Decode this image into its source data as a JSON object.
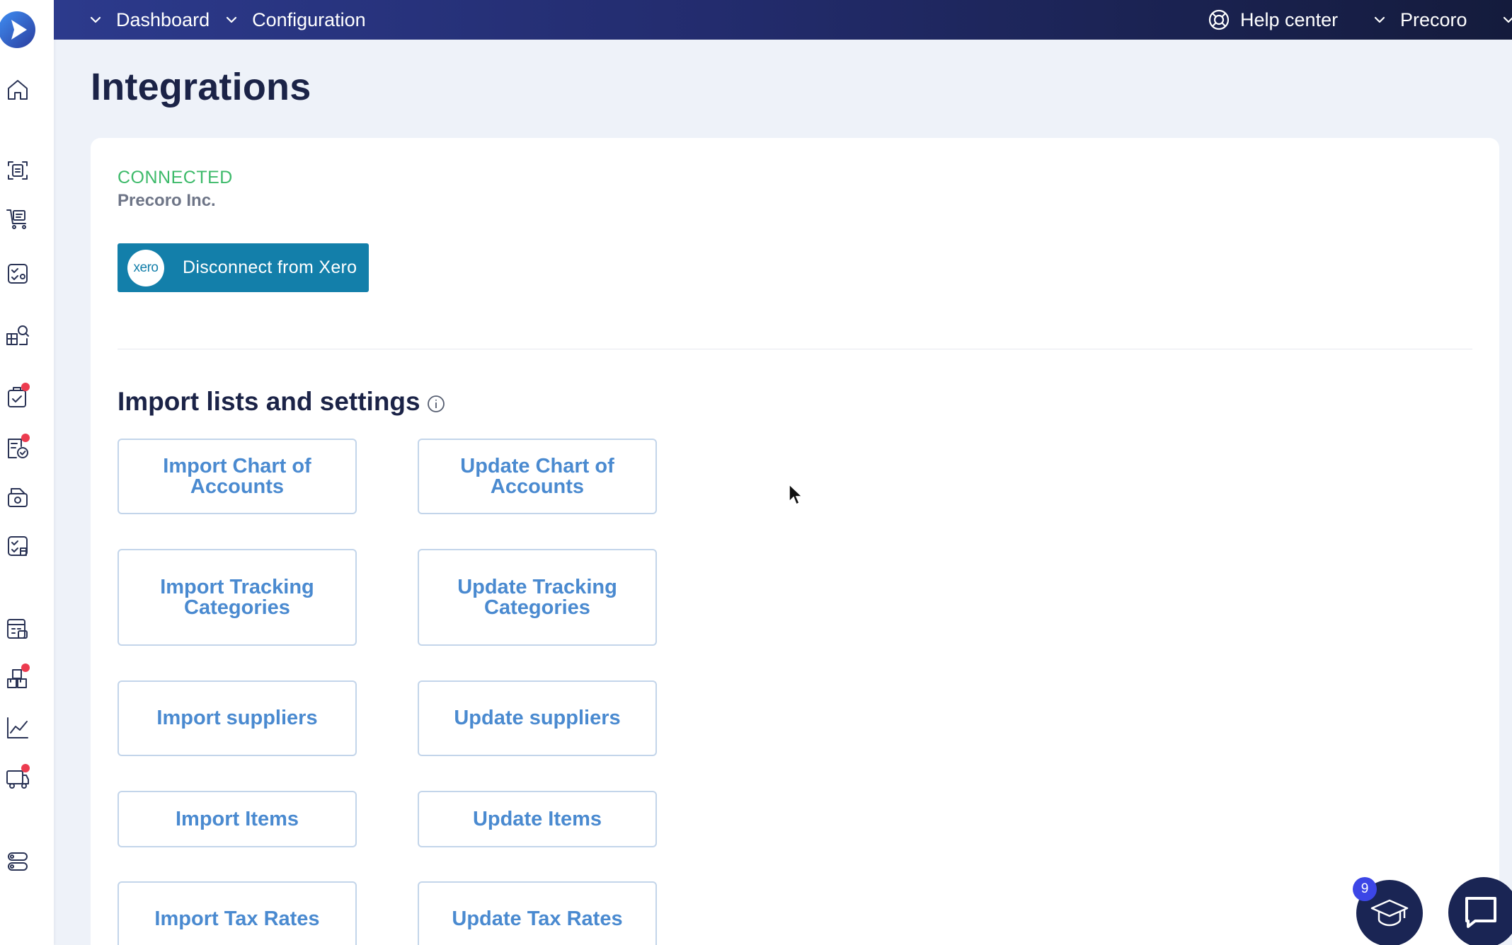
{
  "topbar": {
    "nav": [
      {
        "label": "Dashboard"
      },
      {
        "label": "Configuration"
      }
    ],
    "help_center_label": "Help center",
    "company_switch_label": "Precoro"
  },
  "sidebar": {
    "icons": [
      {
        "name": "home-icon",
        "badge": false
      },
      {
        "name": "requisitions-icon",
        "badge": false
      },
      {
        "name": "purchase-orders-icon",
        "badge": false
      },
      {
        "name": "approvals-icon",
        "badge": false
      },
      {
        "name": "suppliers-search-icon",
        "badge": false
      },
      {
        "name": "receipts-icon",
        "badge": true
      },
      {
        "name": "invoices-icon",
        "badge": true
      },
      {
        "name": "payments-icon",
        "badge": false
      },
      {
        "name": "expenses-icon",
        "badge": false
      },
      {
        "name": "budgets-icon",
        "badge": false
      },
      {
        "name": "inventory-icon",
        "badge": true
      },
      {
        "name": "analytics-icon",
        "badge": false
      },
      {
        "name": "delivery-icon",
        "badge": true
      },
      {
        "name": "settings-toggle-icon",
        "badge": false
      }
    ]
  },
  "page": {
    "title": "Integrations"
  },
  "connection": {
    "status": "CONNECTED",
    "company": "Precoro Inc.",
    "xero_logo_text": "xero",
    "disconnect_label": "Disconnect from Xero"
  },
  "import_section": {
    "title": "Import lists and settings",
    "buttons": [
      {
        "label": "Import Chart of Accounts"
      },
      {
        "label": "Update Chart of Accounts"
      },
      {
        "label": "Import Tracking Categories"
      },
      {
        "label": "Update Tracking Categories"
      },
      {
        "label": "Import suppliers"
      },
      {
        "label": "Update suppliers"
      },
      {
        "label": "Import Items"
      },
      {
        "label": "Update Items"
      },
      {
        "label": "Import Tax Rates"
      },
      {
        "label": "Update Tax Rates"
      }
    ]
  },
  "widgets": {
    "academy_badge_count": "9"
  },
  "colors": {
    "topbar_start": "#2c3a8c",
    "topbar_end": "#141b3c",
    "connected_green": "#3dba6a",
    "xero_blue": "#137faa",
    "button_text_blue": "#4a8ad0",
    "badge_red": "#ec3b4f",
    "widget_navy": "#1a2554"
  }
}
